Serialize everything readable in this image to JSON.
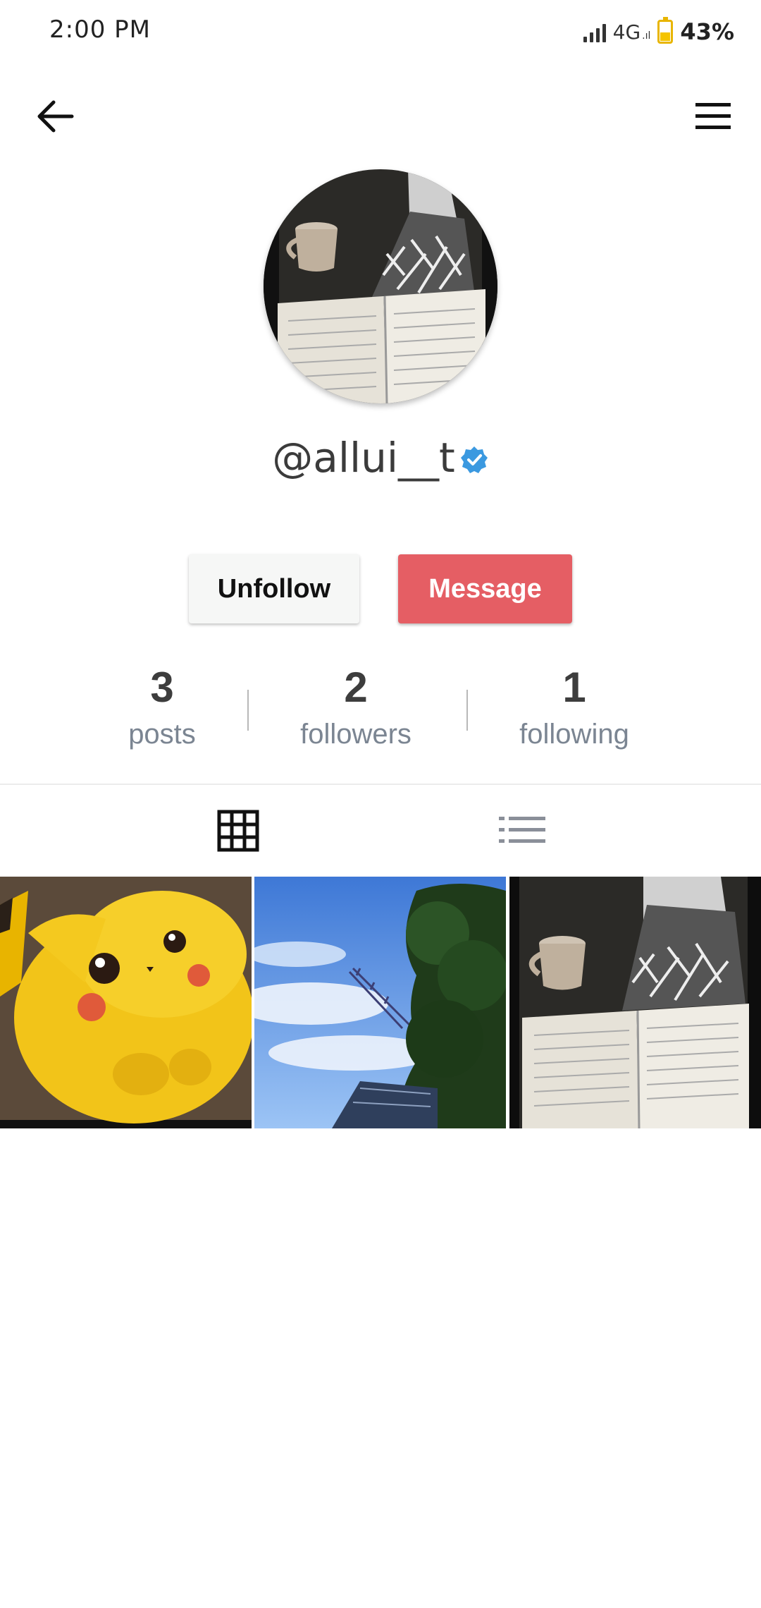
{
  "status_bar": {
    "time": "2:00 PM",
    "network": "4G",
    "battery_percent": "43%"
  },
  "nav": {
    "back_icon": "arrow-left-icon",
    "menu_icon": "hamburger-menu-icon"
  },
  "profile": {
    "username": "@allui__t",
    "verified": true,
    "verified_color": "#3b99e0"
  },
  "actions": {
    "unfollow_label": "Unfollow",
    "message_label": "Message",
    "message_color": "#e55e64"
  },
  "stats": {
    "posts": {
      "count": "3",
      "label": "posts"
    },
    "followers": {
      "count": "2",
      "label": "followers"
    },
    "following": {
      "count": "1",
      "label": "following"
    }
  },
  "tabs": [
    {
      "icon": "grid-icon",
      "active": true
    },
    {
      "icon": "list-icon",
      "active": false
    }
  ],
  "posts": [
    {
      "subject": "pikachu"
    },
    {
      "subject": "sky-tower-trees"
    },
    {
      "subject": "book-coffee"
    }
  ]
}
